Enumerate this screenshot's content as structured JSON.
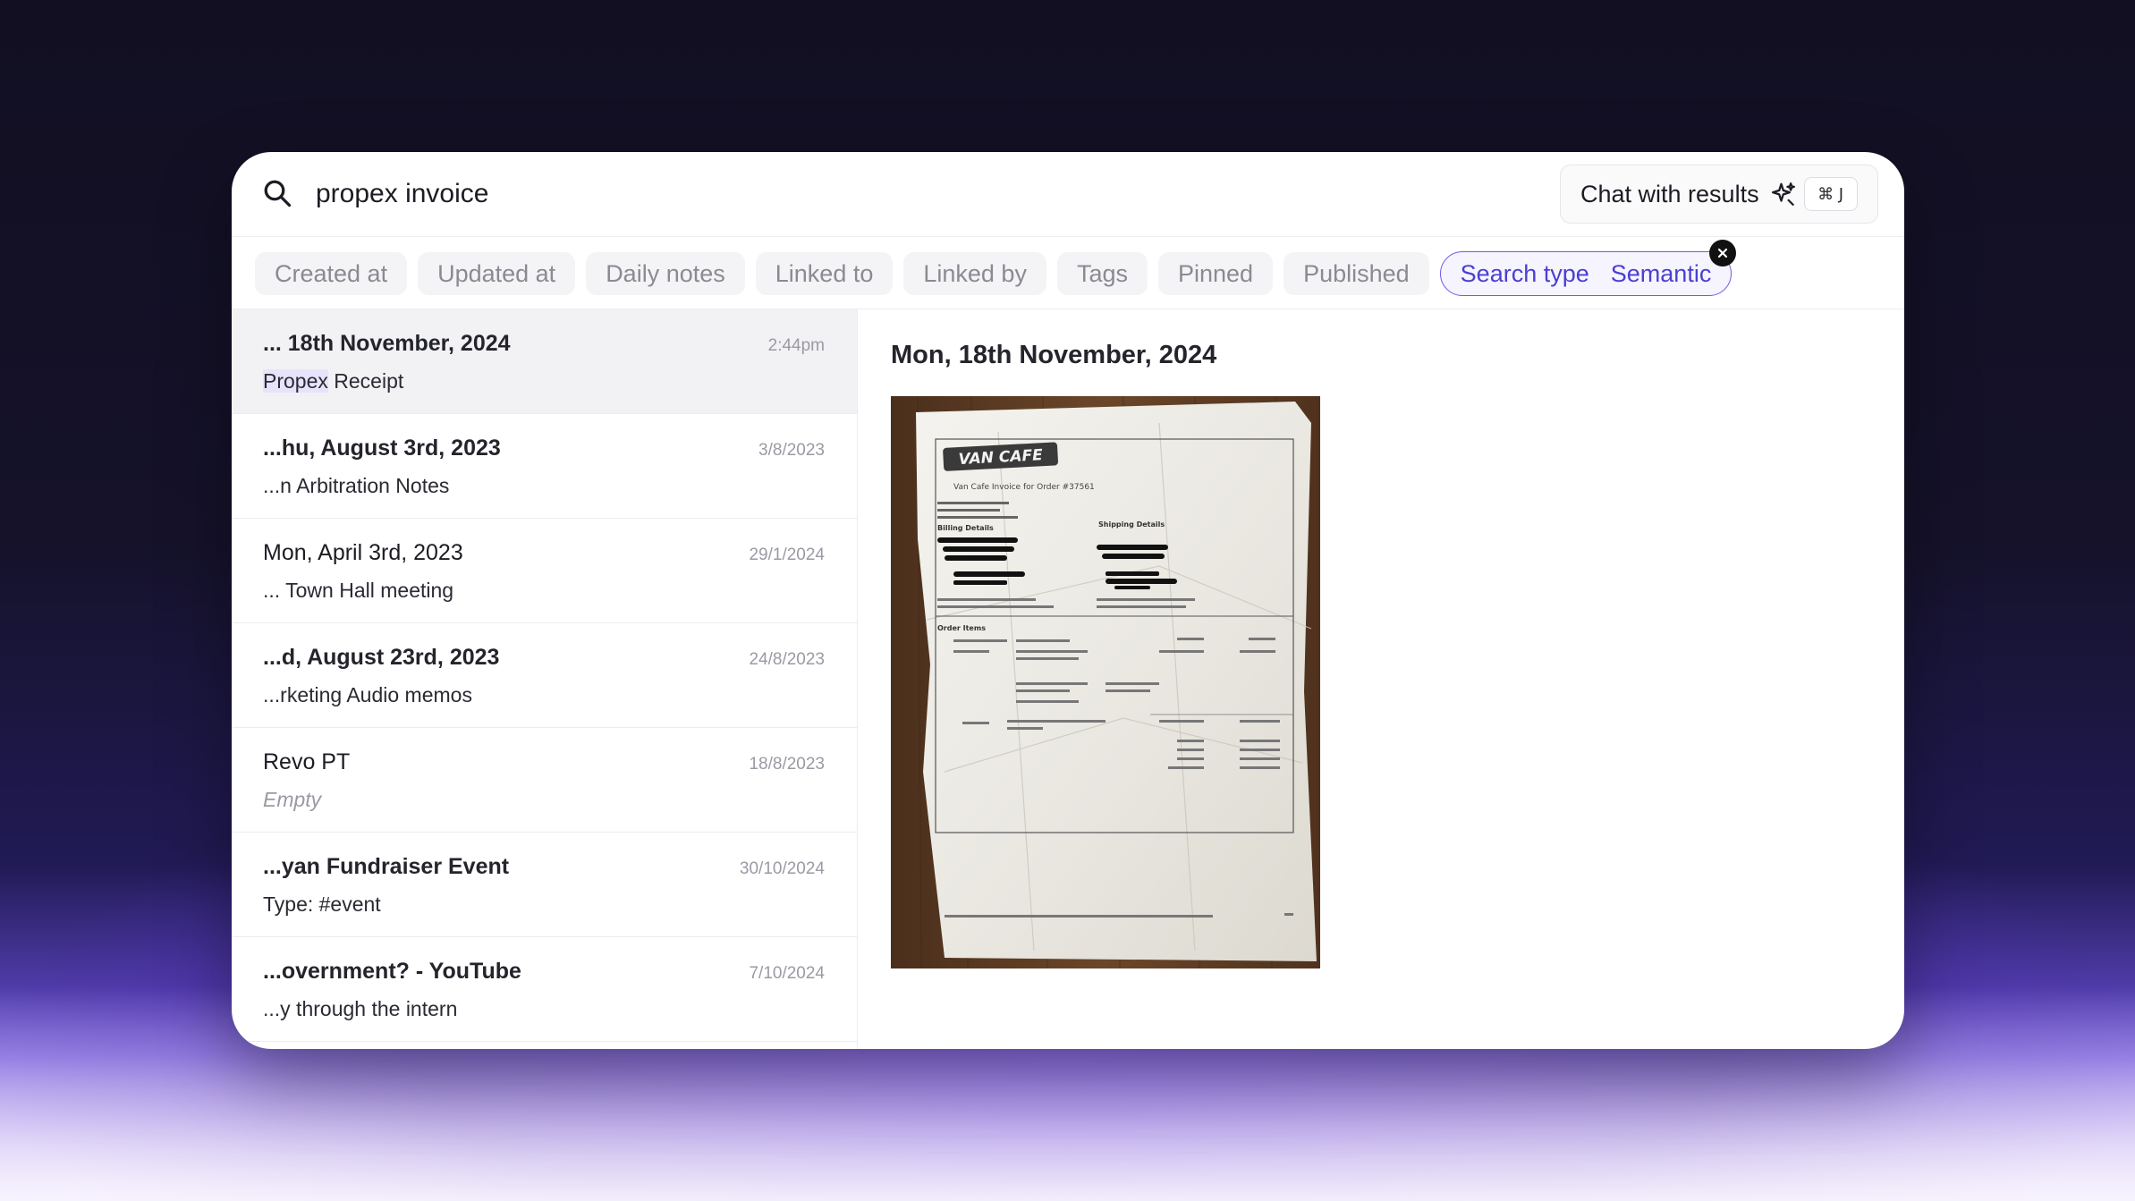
{
  "search": {
    "query": "propex invoice",
    "chat_label": "Chat with results",
    "shortcut": "⌘ J"
  },
  "filters": [
    {
      "label": "Created at"
    },
    {
      "label": "Updated at"
    },
    {
      "label": "Daily notes"
    },
    {
      "label": "Linked to"
    },
    {
      "label": "Linked by"
    },
    {
      "label": "Tags"
    },
    {
      "label": "Pinned"
    },
    {
      "label": "Published"
    }
  ],
  "active_filter": {
    "label": "Search type",
    "value": "Semantic"
  },
  "results": [
    {
      "title": "... 18th November, 2024",
      "sub_highlight": "Propex",
      "sub_rest": " Receipt",
      "date": "2:44pm"
    },
    {
      "title": "...hu, August 3rd, 2023",
      "subtitle": "...n Arbitration Notes",
      "date": "3/8/2023"
    },
    {
      "title": "Mon, April 3rd, 2023",
      "subtitle": "... Town Hall meeting",
      "date": "29/1/2024"
    },
    {
      "title": "...d, August 23rd, 2023",
      "subtitle": "...rketing Audio memos",
      "date": "24/8/2023"
    },
    {
      "title": "Revo PT",
      "subtitle": "Empty",
      "date": "18/8/2023"
    },
    {
      "title": "...yan Fundraiser Event",
      "subtitle": "Type: #event",
      "date": "30/10/2024"
    },
    {
      "title": "...overnment? - YouTube",
      "subtitle": "...y through the intern",
      "date": "7/10/2024"
    }
  ],
  "preview": {
    "title": "Mon, 18th November, 2024",
    "receipt": {
      "brand": "VAN CAFE",
      "order_line": "Van Cafe Invoice for Order #37561",
      "billing_details": "Billing Details",
      "shipping_details": "Shipping Details",
      "order_items": "Order Items"
    }
  },
  "colors": {
    "accent": "#4b3fd0",
    "selected_row": "#f2f2f4"
  }
}
